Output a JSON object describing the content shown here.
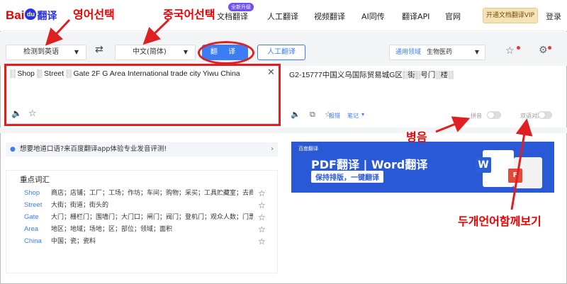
{
  "header": {
    "logo_text": "Bai",
    "logo_paw": "du",
    "logo_suffix": "翻译",
    "nav": [
      "文档翻译",
      "人工翻译",
      "视频翻译",
      "AI同传",
      "翻译API",
      "官网"
    ],
    "new_badge": "全新升级",
    "vip_button": "开通文档翻译VIP",
    "login": "登录"
  },
  "toolbar": {
    "source_lang": "检测到英语",
    "target_lang": "中文(简体)",
    "translate_button": "翻 译",
    "human_button": "人工翻译",
    "domain_label": "通用领域",
    "domain_value": "生物医药"
  },
  "source": {
    "text": "░ Shop ░ Street ░ Gate 2F G Area International trade city Yiwu China"
  },
  "target": {
    "text": "G2-15777中国义乌国际贸易城G区░街░号门░楼░",
    "actions": [
      "报错",
      "笔记"
    ],
    "pinyin_label": "拼音",
    "compare_label": "双语对照"
  },
  "tip": {
    "text": "想要地道口语?来百度翻译app体验专业发音评测!"
  },
  "banner": {
    "brand": "百度翻译",
    "title": "PDF翻译 | Word翻译",
    "subtitle": "保持排版，一键翻译"
  },
  "vocab": {
    "title": "重点词汇",
    "rows": [
      {
        "word": "Shop",
        "meaning": "商店；店铺；工厂；工场；作坊；车间；购物；采买；工具贮藏室；去商..."
      },
      {
        "word": "Street",
        "meaning": "大街；街道；街头的"
      },
      {
        "word": "Gate",
        "meaning": "大门；栅栏门；围墙门；大门口；闸门；阀门；登机门；观众人数；门票..."
      },
      {
        "word": "Area",
        "meaning": "地区；地域；场地；区；部位；领域；面积"
      },
      {
        "word": "China",
        "meaning": "中国；瓷；瓷料"
      }
    ]
  },
  "annotations": {
    "lang_select": "영어선택",
    "chinese_select": "중국어선택",
    "pinyin": "병음",
    "bilingual": "두개언어함께보기"
  },
  "colors": {
    "accent": "#3c7cf5",
    "annotation": "#e02020",
    "banner": "#2a59d8"
  }
}
